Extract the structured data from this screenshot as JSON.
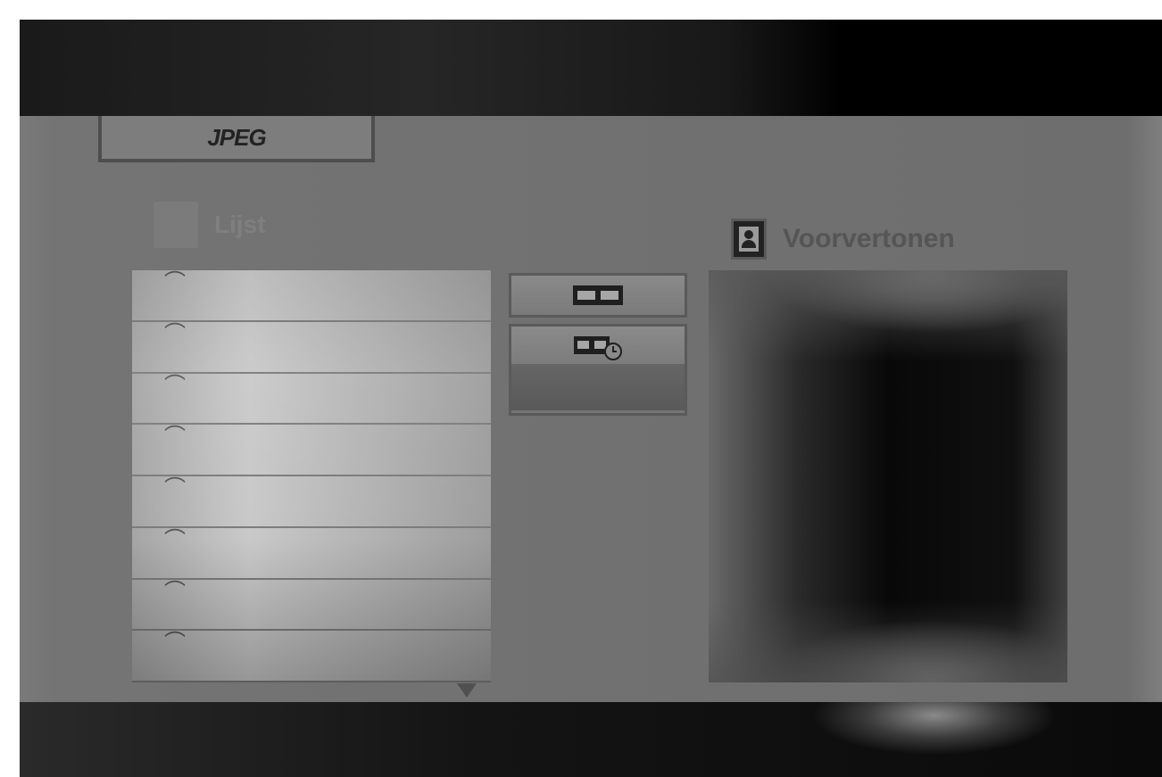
{
  "menu": {
    "title": "JPEG"
  },
  "list": {
    "label": "Lijst",
    "items": [
      {
        "icon": "folder-icon",
        "name": ""
      },
      {
        "icon": "folder-icon",
        "name": ""
      },
      {
        "icon": "folder-icon",
        "name": ""
      },
      {
        "icon": "folder-icon",
        "name": ""
      },
      {
        "icon": "folder-icon",
        "name": ""
      },
      {
        "icon": "folder-icon",
        "name": ""
      },
      {
        "icon": "folder-icon",
        "name": ""
      },
      {
        "icon": "folder-icon",
        "name": ""
      }
    ]
  },
  "buttons": {
    "slideshow_icon": "film-icon",
    "slideshow_timer_icon": "film-clock-icon"
  },
  "preview": {
    "label": "Voorvertonen",
    "icon": "portrait-icon"
  },
  "colors": {
    "panel": "#717171",
    "list_background": "#c2c2c2",
    "preview_background": "#050505",
    "bars": "#0a0a0a"
  }
}
